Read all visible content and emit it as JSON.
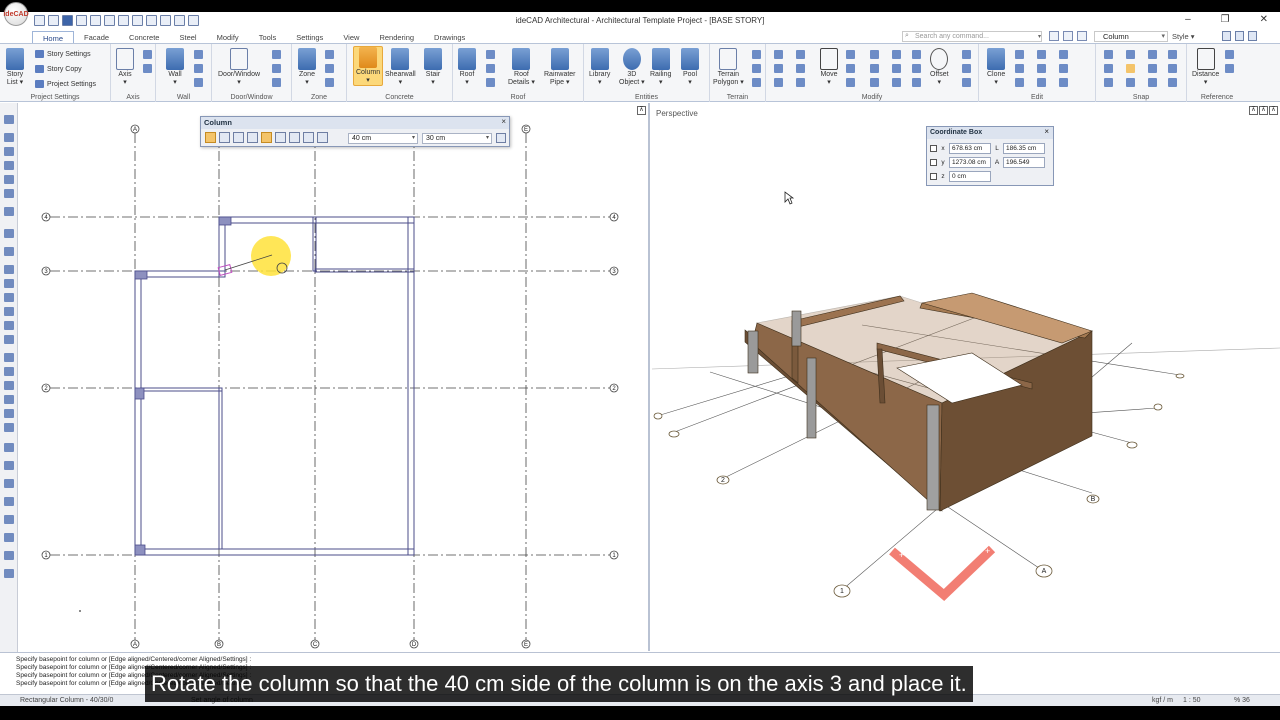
{
  "app": {
    "title": "ideCAD Architectural - Architectural Template Project - [BASE STORY]",
    "logo_text": "ideCAD",
    "window_controls": [
      "–",
      "❐",
      "✕"
    ]
  },
  "tabs": [
    "Home",
    "Facade",
    "Concrete",
    "Steel",
    "Modify",
    "Tools",
    "Settings",
    "View",
    "Rendering",
    "Drawings"
  ],
  "search": {
    "placeholder": "Search any command..."
  },
  "command_select": {
    "value": "Column"
  },
  "style_label": "Style ▾",
  "ribbon": {
    "project_settings": {
      "label": "Project Settings",
      "story_list": "Story\nList ▾",
      "story_settings": "Story Settings",
      "story_copy": "Story Copy",
      "project_settings_btn": "Project Settings"
    },
    "axis": {
      "label": "Axis",
      "axis_btn": "Axis\n▾"
    },
    "wall": {
      "label": "Wall",
      "wall_btn": "Wall\n▾"
    },
    "door_window": {
      "label": "Door/Window",
      "btn": "Door/Window\n▾"
    },
    "zone": {
      "label": "Zone",
      "btn": "Zone\n▾"
    },
    "concrete": {
      "label": "Concrete",
      "column": "Column\n▾",
      "shearwall": "Shearwall\n▾",
      "stair": "Stair\n▾"
    },
    "roof": {
      "label": "Roof",
      "roof": "Roof\n▾",
      "roof_details": "Roof\nDetails ▾",
      "rainwater": "Rainwater\nPipe ▾"
    },
    "entities": {
      "label": "Entities",
      "library": "Library\n▾",
      "object3d": "3D\nObject ▾",
      "railing": "Railing\n▾",
      "pool": "Pool\n▾"
    },
    "terrain": {
      "label": "Terrain",
      "btn": "Terrain\nPolygon ▾"
    },
    "modify": {
      "label": "Modify",
      "move": "Move\n▾",
      "offset": "Offset\n▾"
    },
    "edit": {
      "label": "Edit",
      "clone": "Clone\n▾"
    },
    "snap": {
      "label": "Snap"
    },
    "reference": {
      "label": "Reference",
      "distance": "Distance\n▾"
    }
  },
  "column_toolbar": {
    "title": "Column",
    "close": "×",
    "width_value": "40 cm",
    "depth_value": "30 cm"
  },
  "perspective": {
    "label": "Perspective"
  },
  "coordinate_box": {
    "title": "Coordinate Box",
    "close": "×",
    "x_label": "x",
    "x_value": "678.63 cm",
    "y_label": "y",
    "y_value": "1273.08 cm",
    "z_label": "z",
    "z_value": "0 cm",
    "l_label": "L",
    "l_value": "186.35 cm",
    "a_label": "A",
    "a_value": "196.549"
  },
  "plan": {
    "axes_letters": [
      "A",
      "B",
      "C",
      "D",
      "E"
    ],
    "axes_numbers": [
      "4",
      "3",
      "2",
      "1"
    ]
  },
  "persp_axis_labels": {
    "one": "1",
    "two": "2",
    "a": "A",
    "b": "B"
  },
  "command_lines": [
    "Specify basepoint for column or [Edge aligned/Centered/corner Aligned/Settings] :",
    "Specify basepoint for column or [Edge aligned/Centered/corner Aligned/Settings] :",
    "Specify basepoint for column or [Edge aligned/Centered/corner Aligned/Settings] :",
    "Specify basepoint for column or [Edge aligned/Centered/corner Aligned/Settings] :"
  ],
  "status": {
    "left": "Rectangular Column - 40/30/0",
    "mid": "Set angle of column",
    "pg": "kgf / m",
    "scale": "1 : 50",
    "zoom": "% 36"
  },
  "subtitle": "Rotate the column so that the 40 cm side of the column is on the axis 3 and place it."
}
